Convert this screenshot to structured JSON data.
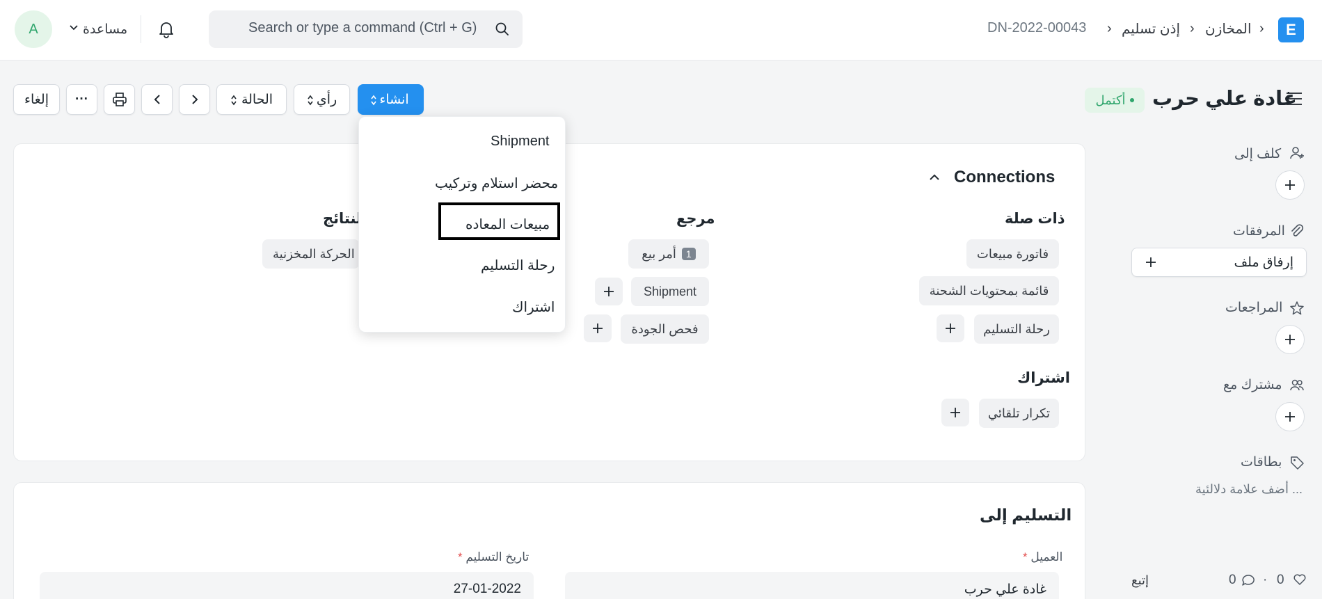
{
  "navbar": {
    "logo_letter": "E",
    "breadcrumbs": [
      "المخازن",
      "إذن تسليم",
      "DN-2022-00043"
    ],
    "search_placeholder": "Search or type a command (Ctrl + G)",
    "help_label": "مساعدة",
    "avatar_letter": "A"
  },
  "page": {
    "title": "غادة علي حرب",
    "status_badge": "أكتمل",
    "status_color": "#30a66d"
  },
  "toolbar": {
    "create_label": "انشاء",
    "view_label": "رأي",
    "status_label": "الحالة",
    "cancel_label": "إلغاء",
    "more_label": "···"
  },
  "create_menu": {
    "items": [
      "Shipment",
      "محضر استلام وتركيب",
      "مبيعات المعاده",
      "رحلة التسليم",
      "اشتراك"
    ],
    "highlighted_index": 2
  },
  "connections": {
    "title": "Connections",
    "groups": {
      "related": {
        "title": "ذات صلة",
        "items": [
          "فاتورة مبيعات",
          "قائمة بمحتويات الشحنة",
          "رحلة التسليم"
        ]
      },
      "reference": {
        "title": "مرجع",
        "items": [
          {
            "label": "أمر بيع",
            "count": "1"
          },
          {
            "label": "Shipment"
          },
          {
            "label": "فحص الجودة"
          }
        ]
      },
      "results": {
        "title": "النتائج",
        "items": [
          "الحركة المخزنية"
        ]
      },
      "subscription": {
        "title": "اشتراك",
        "items": [
          "تكرار تلقائي"
        ]
      }
    }
  },
  "delivery": {
    "title": "التسليم إلى",
    "customer_label": "العميل",
    "customer_value": "غادة علي حرب",
    "date_label": "تاريخ التسليم",
    "date_value": "27-01-2022",
    "required_mark": "*"
  },
  "sidebar": {
    "assign_label": "كلف إلى",
    "attachments_label": "المرفقات",
    "attach_file_label": "إرفاق ملف",
    "reviews_label": "المراجعات",
    "shared_label": "مشترك مع",
    "tags_label": "بطاقات",
    "add_tag_placeholder": "أضف علامة دلالئية ...",
    "likes_count": "0",
    "comments_count": "0",
    "follow_label": "إتبع"
  }
}
